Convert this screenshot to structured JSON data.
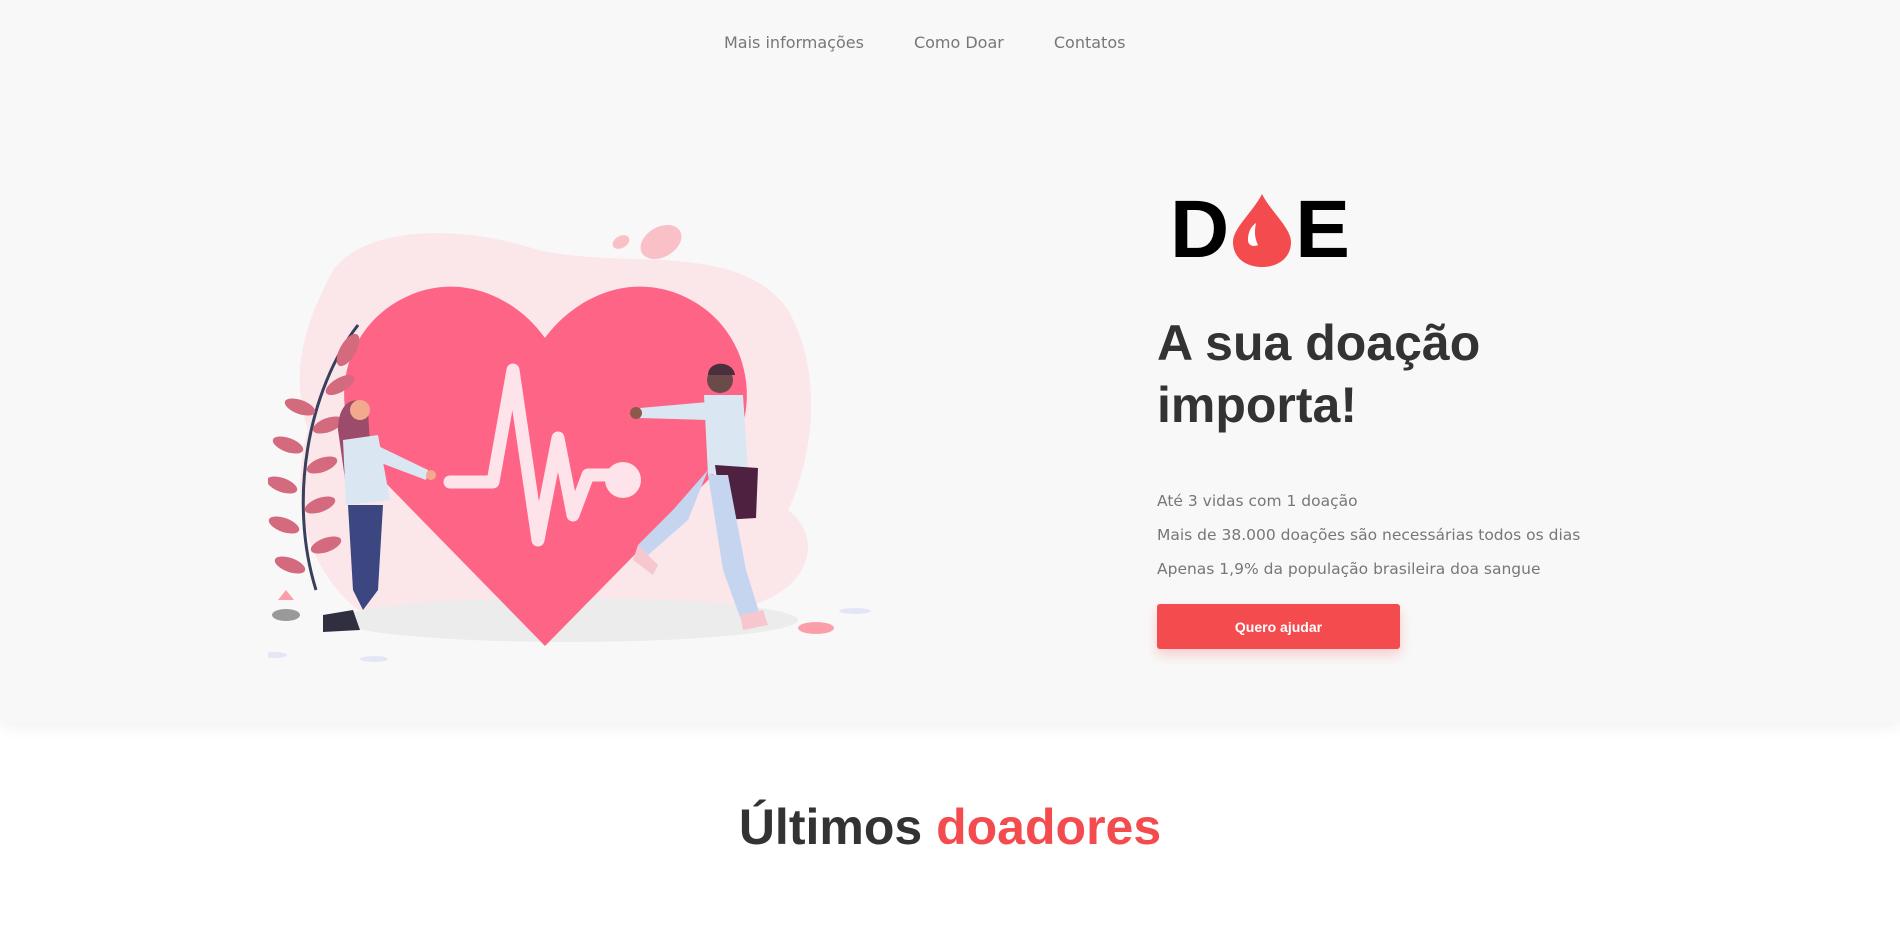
{
  "nav": {
    "links": [
      "Mais informações",
      "Como Doar",
      "Contatos"
    ]
  },
  "logo": {
    "left": "D",
    "right": "E"
  },
  "hero": {
    "headline_line1": "A sua doação",
    "headline_line2": "importa!",
    "stats": [
      "Até 3 vidas com 1 doação",
      "Mais de 38.000 doações são necessárias todos os dias",
      "Apenas 1,9% da população brasileira doa sangue"
    ],
    "cta_label": "Quero ajudar"
  },
  "donors": {
    "title_part1": "Últimos",
    "title_part2": "doadores"
  },
  "colors": {
    "accent": "#f44b4e",
    "heart": "#fe6485",
    "text_dark": "#333333",
    "text_muted": "#777777"
  },
  "icons": [
    "blood-drop-icon",
    "heart-pulse-illustration"
  ]
}
